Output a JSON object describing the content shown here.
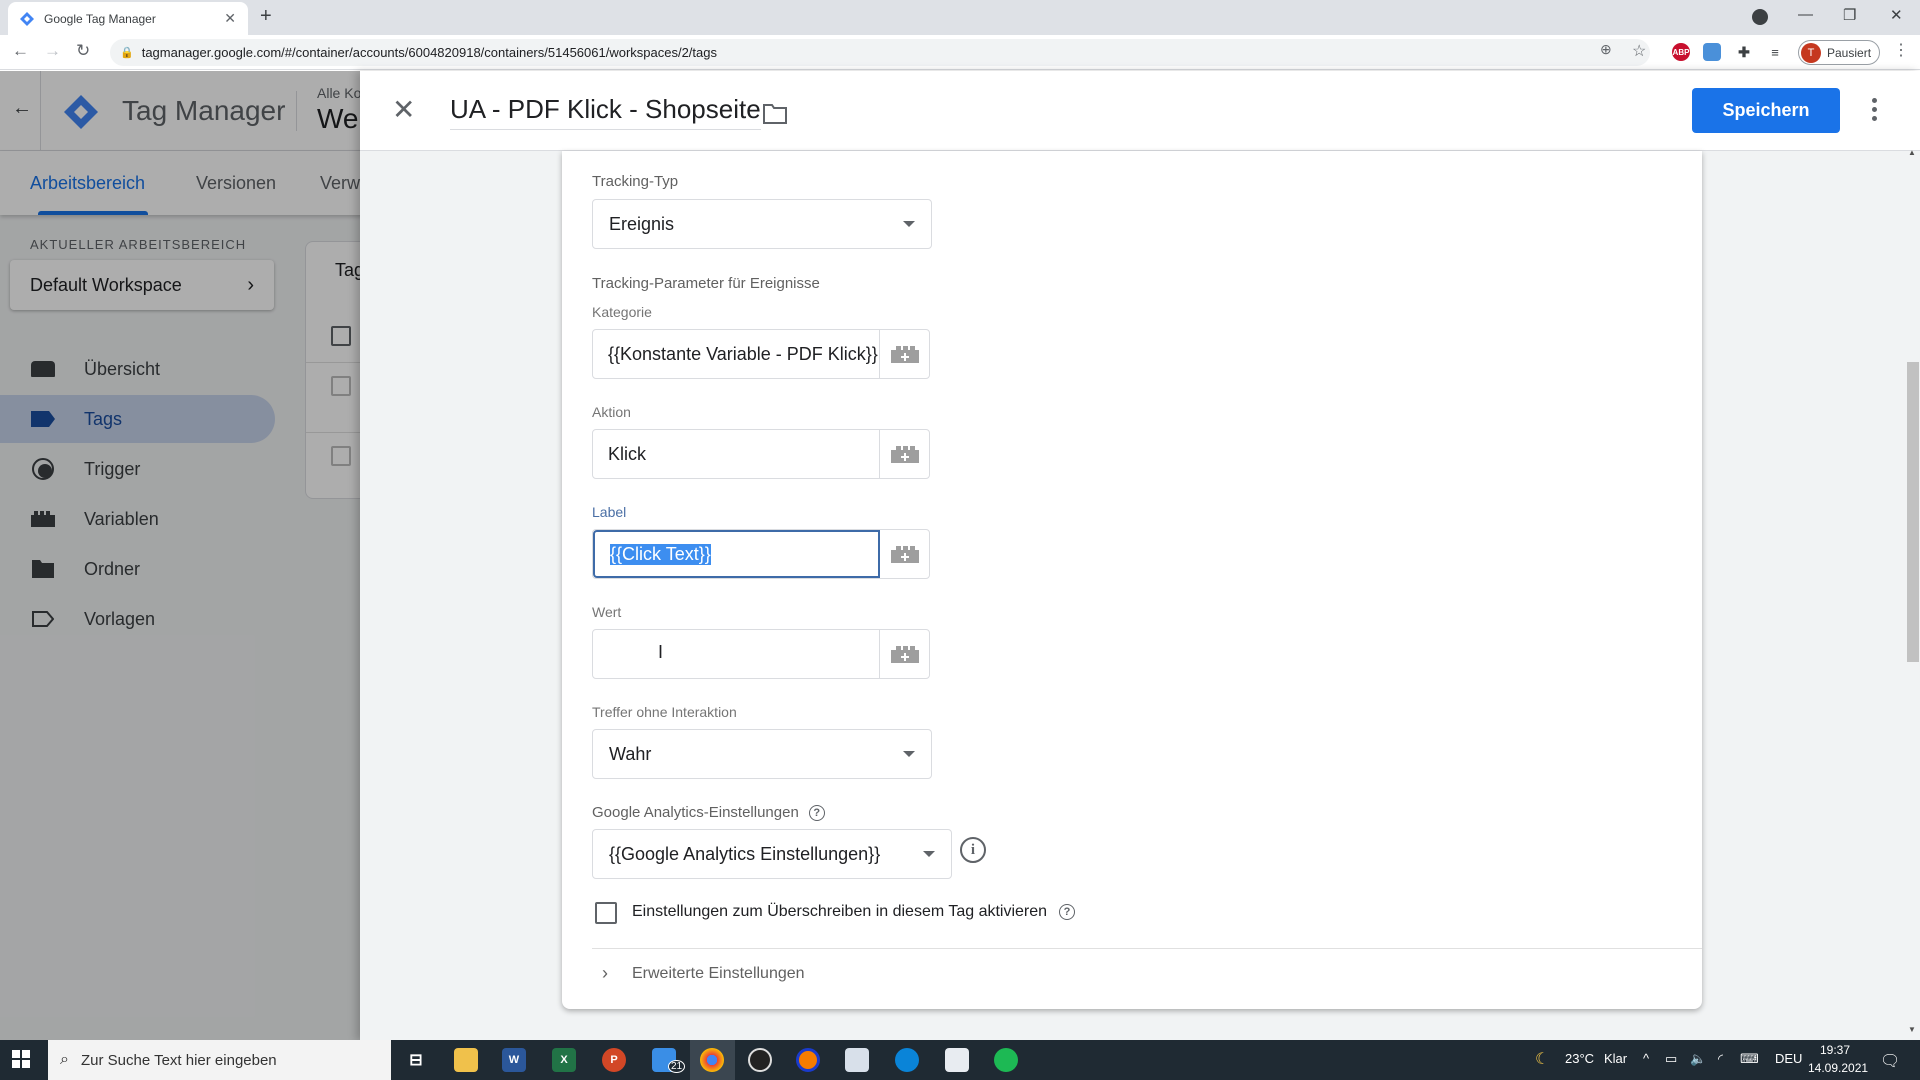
{
  "browser": {
    "tab_title": "Google Tag Manager",
    "url": "tagmanager.google.com/#/container/accounts/6004820918/containers/51456061/workspaces/2/tags",
    "profile_initial": "T",
    "profile_status": "Pausiert",
    "extensions": [
      "abp-icon",
      "tag-assistant-icon",
      "puzzle-icon",
      "media-icon"
    ]
  },
  "app": {
    "product": "Tag Manager",
    "account_crumb": "Alle Ko",
    "container_name": "We",
    "tabs": [
      {
        "label": "Arbeitsbereich",
        "active": true
      },
      {
        "label": "Versionen",
        "active": false
      },
      {
        "label": "Verw",
        "active": false
      }
    ],
    "workspace_heading": "AKTUELLER ARBEITSBEREICH",
    "workspace_name": "Default Workspace",
    "nav": [
      {
        "label": "Übersicht",
        "icon": "overview-icon",
        "active": false
      },
      {
        "label": "Tags",
        "icon": "tag-icon",
        "active": true
      },
      {
        "label": "Trigger",
        "icon": "trigger-icon",
        "active": false
      },
      {
        "label": "Variablen",
        "icon": "variables-icon",
        "active": false
      },
      {
        "label": "Ordner",
        "icon": "folder-icon",
        "active": false
      },
      {
        "label": "Vorlagen",
        "icon": "templates-icon",
        "active": false
      }
    ],
    "tags_card_title": "Tag"
  },
  "editor": {
    "tag_name": "UA - PDF Klick - Shopseite",
    "save_label": "Speichern",
    "tracking_type": {
      "label": "Tracking-Typ",
      "value": "Ereignis"
    },
    "params_heading": "Tracking-Parameter für Ereignisse",
    "kategorie": {
      "label": "Kategorie",
      "value": "{{Konstante Variable - PDF Klick}}"
    },
    "aktion": {
      "label": "Aktion",
      "value": "Klick"
    },
    "label": {
      "label": "Label",
      "value": "{{Click Text}}"
    },
    "wert": {
      "label": "Wert",
      "value": ""
    },
    "non_interaction": {
      "label": "Treffer ohne Interaktion",
      "value": "Wahr"
    },
    "ga_settings": {
      "label": "Google Analytics-Einstellungen",
      "value": "{{Google Analytics Einstellungen}}"
    },
    "override_label": "Einstellungen zum Überschreiben in diesem Tag aktivieren",
    "override_checked": false,
    "advanced_label": "Erweiterte Einstellungen"
  },
  "taskbar": {
    "search_placeholder": "Zur Suche Text hier eingeben",
    "mail_badge": "21",
    "weather": "23°C",
    "weather_desc": "Klar",
    "language": "DEU",
    "time": "19:37",
    "date": "14.09.2021"
  }
}
